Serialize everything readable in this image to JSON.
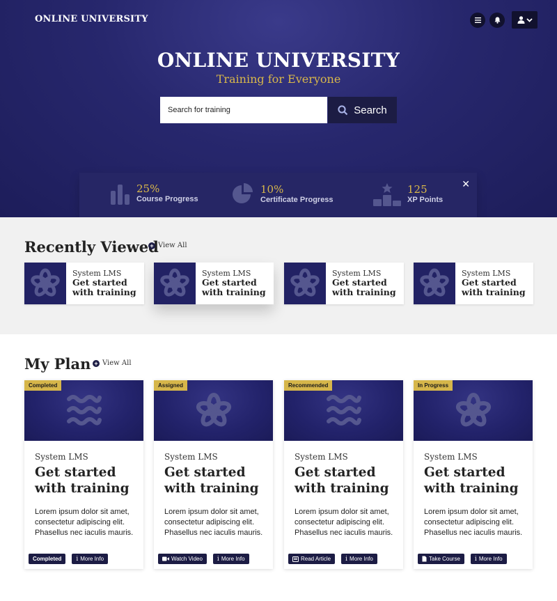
{
  "header": {
    "brand": "ONLINE UNIVERSITY",
    "icons": [
      "menu-icon",
      "bell-icon",
      "user-icon",
      "chevron-down-icon"
    ]
  },
  "hero": {
    "title": "ONLINE UNIVERSITY",
    "subtitle": "Training for Everyone",
    "search_placeholder": "Search for training",
    "search_button": "Search"
  },
  "stats": [
    {
      "value": "25%",
      "label": "Course Progress",
      "icon": "bar-chart-icon"
    },
    {
      "value": "10%",
      "label": "Certificate Progress",
      "icon": "pie-chart-icon"
    },
    {
      "value": "125",
      "label": "XP Points",
      "icon": "podium-icon"
    }
  ],
  "recently_viewed": {
    "title": "Recently Viewed",
    "view_all": "View All",
    "items": [
      {
        "org": "System LMS",
        "title_line1": "Get started",
        "title_line2": "with training"
      },
      {
        "org": "System LMS",
        "title_line1": "Get started",
        "title_line2": "with training"
      },
      {
        "org": "System LMS",
        "title_line1": "Get started",
        "title_line2": "with training"
      },
      {
        "org": "System LMS",
        "title_line1": "Get started",
        "title_line2": "with training"
      }
    ]
  },
  "my_plan": {
    "title": "My Plan",
    "view_all": "View All",
    "cards": [
      {
        "badge": "Completed",
        "org": "System LMS",
        "title_line1": "Get started",
        "title_line2": "with training",
        "desc_line1": "Lorem ipsum dolor sit amet,",
        "desc_line2": "consectetur adipiscing elit.",
        "desc_line3": "Phasellus nec iaculis mauris.",
        "primary": "Completed",
        "secondary": "More Info",
        "image_icon": "waves-icon"
      },
      {
        "badge": "Assigned",
        "org": "System LMS",
        "title_line1": "Get started",
        "title_line2": "with training",
        "desc_line1": "Lorem ipsum dolor sit amet,",
        "desc_line2": "consectetur adipiscing elit.",
        "desc_line3": "Phasellus nec iaculis mauris.",
        "primary": "Watch Video",
        "secondary": "More Info",
        "image_icon": "flower-icon"
      },
      {
        "badge": "Recommended",
        "org": "System LMS",
        "title_line1": "Get started",
        "title_line2": "with training",
        "desc_line1": "Lorem ipsum dolor sit amet,",
        "desc_line2": "consectetur adipiscing elit.",
        "desc_line3": "Phasellus nec iaculis mauris.",
        "primary": "Read Article",
        "secondary": "More Info",
        "image_icon": "waves-icon"
      },
      {
        "badge": "In Progress",
        "org": "System LMS",
        "title_line1": "Get started",
        "title_line2": "with training",
        "desc_line1": "Lorem ipsum dolor sit amet,",
        "desc_line2": "consectetur adipiscing elit.",
        "desc_line3": "Phasellus nec iaculis mauris.",
        "primary": "Take Course",
        "secondary": "More Info",
        "image_icon": "flower-icon"
      }
    ]
  },
  "colors": {
    "navy": "#27276d",
    "gold": "#d9b84a",
    "dark_button": "#1c1c44"
  }
}
